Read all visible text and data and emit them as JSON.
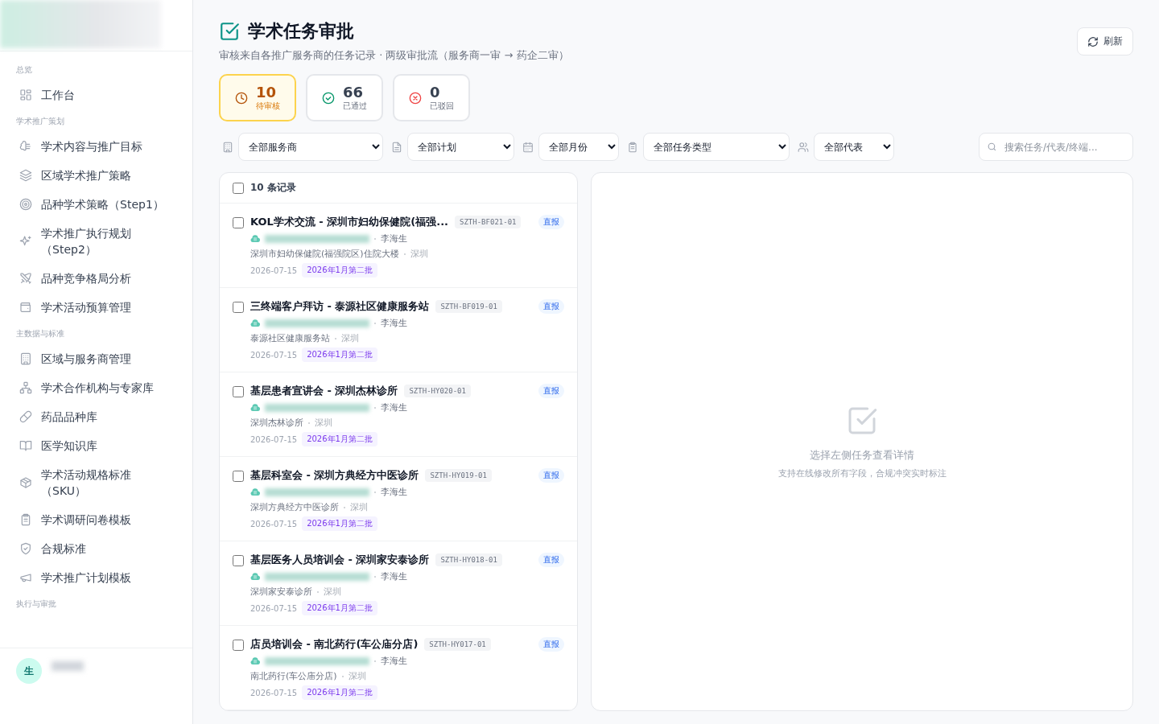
{
  "sidebar": {
    "sections": [
      {
        "title": "总览",
        "items": [
          {
            "label": "工作台"
          }
        ]
      },
      {
        "title": "学术推广策划",
        "items": [
          {
            "label": "学术内容与推广目标"
          },
          {
            "label": "区域学术推广策略"
          },
          {
            "label": "品种学术策略（Step1）"
          },
          {
            "label": "学术推广执行规划（Step2）"
          },
          {
            "label": "品种竞争格局分析"
          },
          {
            "label": "学术活动预算管理"
          }
        ]
      },
      {
        "title": "主数据与标准",
        "items": [
          {
            "label": "区域与服务商管理"
          },
          {
            "label": "学术合作机构与专家库"
          },
          {
            "label": "药品品种库"
          },
          {
            "label": "医学知识库"
          },
          {
            "label": "学术活动规格标准（SKU）"
          },
          {
            "label": "学术调研问卷模板"
          },
          {
            "label": "合规标准"
          },
          {
            "label": "学术推广计划模板"
          }
        ]
      },
      {
        "title": "执行与审批"
      }
    ],
    "user": {
      "avatar": "生"
    }
  },
  "header": {
    "title": "学术任务审批",
    "subtitle": "审核来自各推广服务商的任务记录 · 两级审批流（服务商一审 → 药企二审）",
    "refresh": "刷新"
  },
  "stats": [
    {
      "kind": "pending",
      "value": "10",
      "label": "待审核",
      "selected": true
    },
    {
      "kind": "approved",
      "value": "66",
      "label": "已通过",
      "selected": false
    },
    {
      "kind": "rejected",
      "value": "0",
      "label": "已驳回",
      "selected": false
    }
  ],
  "filters": [
    {
      "value": "全部服务商"
    },
    {
      "value": "全部计划"
    },
    {
      "value": "全部月份"
    },
    {
      "value": "全部任务类型"
    },
    {
      "value": "全部代表"
    }
  ],
  "search": {
    "placeholder": "搜索任务/代表/终端..."
  },
  "list": {
    "count_label": "10 条记录",
    "checked": false,
    "rows": [
      {
        "title": "KOL学术交流 - 深圳市妇幼保健院(福强...",
        "code": "SZTH-BF021-01",
        "tag": "直报",
        "rep": "李海生",
        "site": "深圳市妇幼保健院(福强院区)住院大楼",
        "city": "深圳",
        "date": "2026-07-15",
        "batch": "2026年1月第二批",
        "checked": false
      },
      {
        "title": "三终端客户拜访 - 泰源社区健康服务站",
        "code": "SZTH-BF019-01",
        "tag": "直报",
        "rep": "李海生",
        "site": "泰源社区健康服务站",
        "city": "深圳",
        "date": "2026-07-15",
        "batch": "2026年1月第二批",
        "checked": false
      },
      {
        "title": "基层患者宣讲会 - 深圳杰林诊所",
        "code": "SZTH-HY020-01",
        "tag": "直报",
        "rep": "李海生",
        "site": "深圳杰林诊所",
        "city": "深圳",
        "date": "2026-07-15",
        "batch": "2026年1月第二批",
        "checked": false
      },
      {
        "title": "基层科室会 - 深圳方典经方中医诊所",
        "code": "SZTH-HY019-01",
        "tag": "直报",
        "rep": "李海生",
        "site": "深圳方典经方中医诊所",
        "city": "深圳",
        "date": "2026-07-15",
        "batch": "2026年1月第二批",
        "checked": false
      },
      {
        "title": "基层医务人员培训会 - 深圳家安泰诊所",
        "code": "SZTH-HY018-01",
        "tag": "直报",
        "rep": "李海生",
        "site": "深圳家安泰诊所",
        "city": "深圳",
        "date": "2026-07-15",
        "batch": "2026年1月第二批",
        "checked": false
      },
      {
        "title": "店员培训会 - 南北药行(车公庙分店)",
        "code": "SZTH-HY017-01",
        "tag": "直报",
        "rep": "李海生",
        "site": "南北药行(车公庙分店)",
        "city": "深圳",
        "date": "2026-07-15",
        "batch": "2026年1月第二批",
        "checked": false
      }
    ]
  },
  "detail": {
    "empty_title": "选择左侧任务查看详情",
    "empty_hint": "支持在线修改所有字段，合规冲突实时标注"
  }
}
